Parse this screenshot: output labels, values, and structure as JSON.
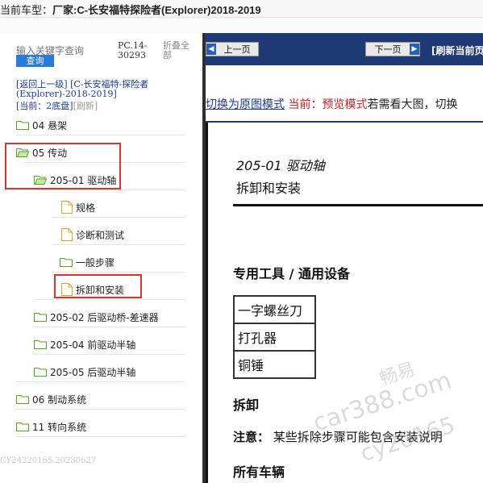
{
  "header": {
    "vehicle_label": "当前车型：",
    "vehicle_value": "厂家:C-长安福特探险者(Explorer)2018-2019"
  },
  "sidebar": {
    "search_placeholder": "输入关键字查询",
    "search_button": "查询",
    "pc_code": "PC.14-30293",
    "collapse_all": "折叠全部",
    "breadcrumb": {
      "back": "[返回上一级]",
      "path": "[C-长安福特-探险者(Explorer)-2018-2019]"
    },
    "current": {
      "label": "[当前：",
      "value": "2",
      "base": "底盘]",
      "refresh": "[刷新]"
    },
    "tree": [
      {
        "label": "04 悬架",
        "icon": "folder-icon"
      },
      {
        "label": "05 传动",
        "icon": "folder-open-icon"
      },
      {
        "label": "205-01 驱动轴",
        "icon": "folder-open-icon"
      },
      {
        "label": "规格",
        "icon": "document-icon"
      },
      {
        "label": "诊断和测试",
        "icon": "document-icon"
      },
      {
        "label": "一般步骤",
        "icon": "folder-icon"
      },
      {
        "label": "拆卸和安装",
        "icon": "document-icon"
      },
      {
        "label": "205-02 后驱动桥-差速器",
        "icon": "folder-icon"
      },
      {
        "label": "205-04 前驱动半轴",
        "icon": "folder-icon"
      },
      {
        "label": "205-05 后驱动半轴",
        "icon": "folder-icon"
      },
      {
        "label": "06 制动系统",
        "icon": "folder-icon"
      },
      {
        "label": "11 转向系统",
        "icon": "folder-icon"
      }
    ],
    "footer_code": "CY24220165.20230627"
  },
  "viewer": {
    "prev_button": "上一页",
    "next_button": "下一页",
    "refresh_label": "[刷新当前页",
    "mode_switch": "切换为原图模式",
    "mode_current": "当前：预览模式",
    "mode_hint": "若需看大图，切换"
  },
  "document": {
    "section_number": "205-01 驱动轴",
    "section_title": "拆卸和安装",
    "tools_heading": "专用工具 / 通用设备",
    "tools": [
      "一字螺丝刀",
      "打孔器",
      "铜锤"
    ],
    "removal_heading": "拆卸",
    "note_label": "注意：",
    "note_text": "某些拆除步骤可能包含安装说明",
    "all_vehicles": "所有车辆"
  },
  "watermark": {
    "line1": "畅易",
    "line2": "car388.com",
    "line3": "cy20165"
  },
  "colors": {
    "navbar": "#1f3a74",
    "highlight": "#e03030",
    "search_button": "#2b7ad6",
    "link": "#1c3a9a",
    "folder": "#7cc043",
    "document": "#f0b840"
  }
}
